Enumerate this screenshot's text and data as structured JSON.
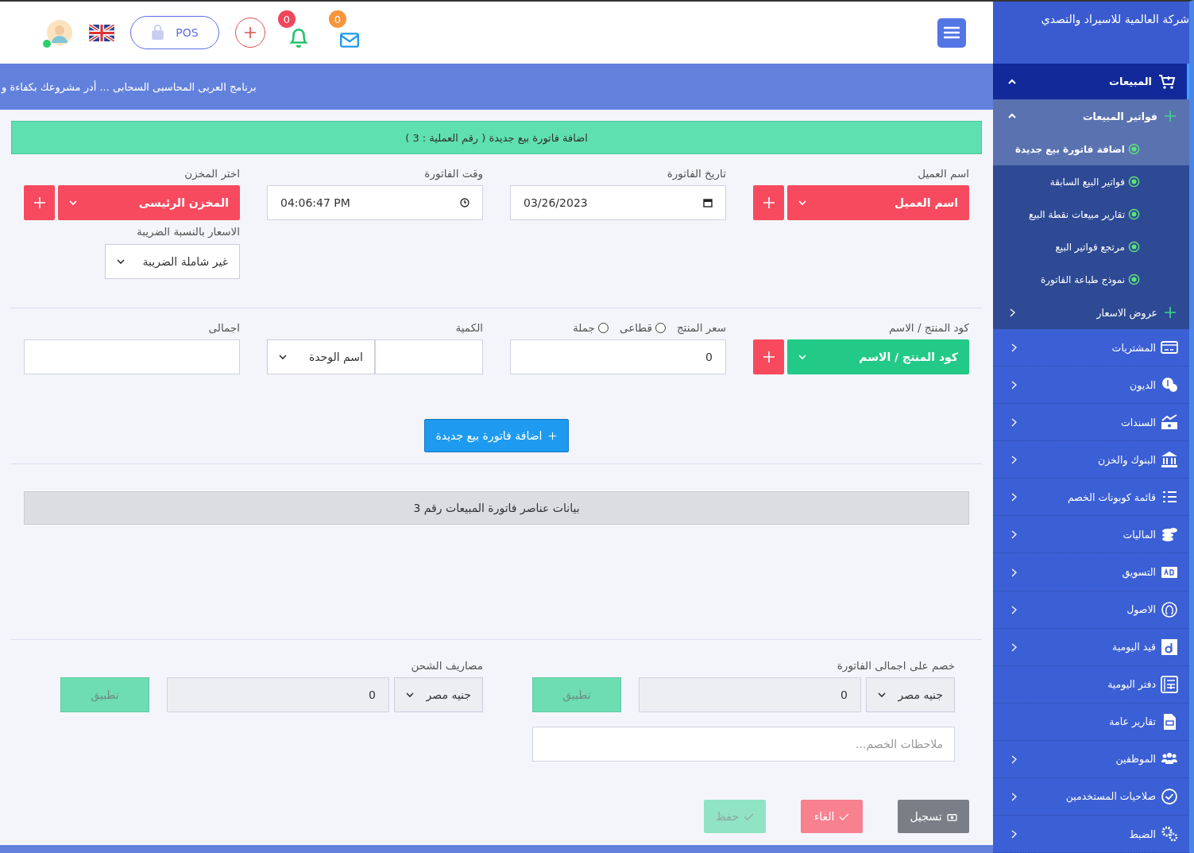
{
  "header": {
    "pos_label": "POS",
    "notifications_count": "0",
    "messages_count": "0"
  },
  "banner": {
    "text": "برنامج العربى المحاسبى السحابى ... أدر مشروعك بكفاءة و"
  },
  "sidebar": {
    "company": "شركة العالمية للاسيراد والتصدي",
    "menu": [
      {
        "label": "المبيعات",
        "kind": "group",
        "expanded": true,
        "selected": true,
        "children": [
          {
            "label": "فواتير المبيعات",
            "expanded": true,
            "children": [
              {
                "label": "اضافة فاتورة بيع جديدة",
                "selected": true
              },
              {
                "label": "فواتير البيع السابقة",
                "selected": false
              },
              {
                "label": "تقارير مبيعات نقطة البيع",
                "selected": false
              },
              {
                "label": "مرتجع فواتير البيع",
                "selected": false
              },
              {
                "label": "نموذج طباعة الفاتورة",
                "selected": false
              }
            ]
          },
          {
            "label": "عروض الاسعار",
            "expanded": false
          }
        ]
      },
      {
        "label": "المشتريات",
        "kind": "group",
        "expanded": false
      },
      {
        "label": "الديون",
        "kind": "group",
        "expanded": false
      },
      {
        "label": "السندات",
        "kind": "group",
        "expanded": false
      },
      {
        "label": "البنوك والخزن",
        "kind": "group",
        "expanded": false
      },
      {
        "label": "قائمة كوبونات الخصم",
        "kind": "group",
        "expanded": false
      },
      {
        "label": "الماليات",
        "kind": "group",
        "expanded": false
      },
      {
        "label": "التسويق",
        "kind": "group",
        "expanded": false
      },
      {
        "label": "الاصول",
        "kind": "group",
        "expanded": false
      },
      {
        "label": "قيد اليومية",
        "kind": "group",
        "expanded": false
      },
      {
        "label": "دفتر اليومية",
        "kind": "link"
      },
      {
        "label": "تقارير عامة",
        "kind": "link"
      },
      {
        "label": "الموظفين",
        "kind": "group",
        "expanded": false
      },
      {
        "label": "صلاحيات المستخدمين",
        "kind": "group",
        "expanded": false
      },
      {
        "label": "الضبط",
        "kind": "group",
        "expanded": false
      }
    ]
  },
  "form": {
    "title": "اضافة فاتورة بيع جديدة ( رقم العملية : 3 )",
    "customer": {
      "label": "اسم العميل",
      "value": "اسم العميل"
    },
    "invoice_date": {
      "label": "تاريخ الفاتورة",
      "value": "03/26/2023"
    },
    "invoice_time": {
      "label": "وقت الفاتورة",
      "value": "04:06:47 PM"
    },
    "store": {
      "label": "اختر المخزن",
      "value": "المخزن الرئيسى"
    },
    "tax": {
      "label": "الاسعار بالنسبة الضريبة",
      "value": "غير شاملة الضريبة"
    }
  },
  "item_entry": {
    "product": {
      "label": "كود المنتج / الاسم",
      "value": "كود المنتج / الاسم"
    },
    "price": {
      "label": "سعر المنتج",
      "value": "0",
      "options": [
        {
          "label": "قطاعى",
          "selected": false
        },
        {
          "label": "جملة",
          "selected": false
        }
      ]
    },
    "quantity": {
      "label": "الكمية",
      "unit": "اسم الوحدة"
    },
    "total": {
      "label": "اجمالى"
    }
  },
  "add_button": {
    "label": "اضافة فاتورة بيع جديدة"
  },
  "items_panel": {
    "title": "بيانات عناصر فاتورة المبيعات رقم 3"
  },
  "discount": {
    "label": "خصم على اجمالى الفاتورة",
    "currency": "جنيه مصر",
    "value": "0",
    "apply": "تطبيق",
    "notes_placeholder": "ملاحظات الخصم..."
  },
  "shipping": {
    "label": "مصاريف الشحن",
    "currency": "جنيه مصر",
    "value": "0",
    "apply": "تطبيق"
  },
  "actions": [
    {
      "kind": "register",
      "label": "تسجيل",
      "disabled": false
    },
    {
      "kind": "cancel",
      "label": "الغاء",
      "disabled": false
    },
    {
      "kind": "save",
      "label": "حفظ",
      "disabled": true
    }
  ]
}
